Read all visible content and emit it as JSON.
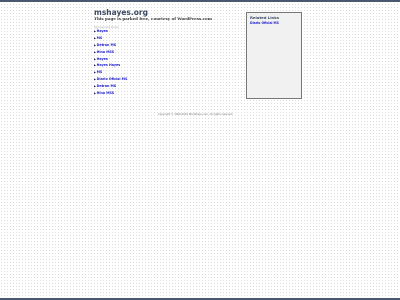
{
  "header": {
    "site_title": "mshayes.org",
    "tagline": "This page is parked free, courtesy of WordPress.com"
  },
  "sponsored_label": "Sponsored Links",
  "links": [
    "Hayes",
    "MS",
    "Detran MS",
    "Hino MSS",
    "Hayes",
    "Hayes Hayes",
    "MS",
    "Diario Oficial MS",
    "Detran MS",
    "Hino MSS"
  ],
  "related": {
    "title": "Related Links",
    "items": [
      "Diario Oficial MS"
    ]
  },
  "footer": {
    "copyright": "Copyright © 2008-2016 WordPress.com. All rights reserved."
  },
  "colors": {
    "bar": "#4a5870",
    "link": "#1a1acc",
    "title": "#3b4a62"
  }
}
